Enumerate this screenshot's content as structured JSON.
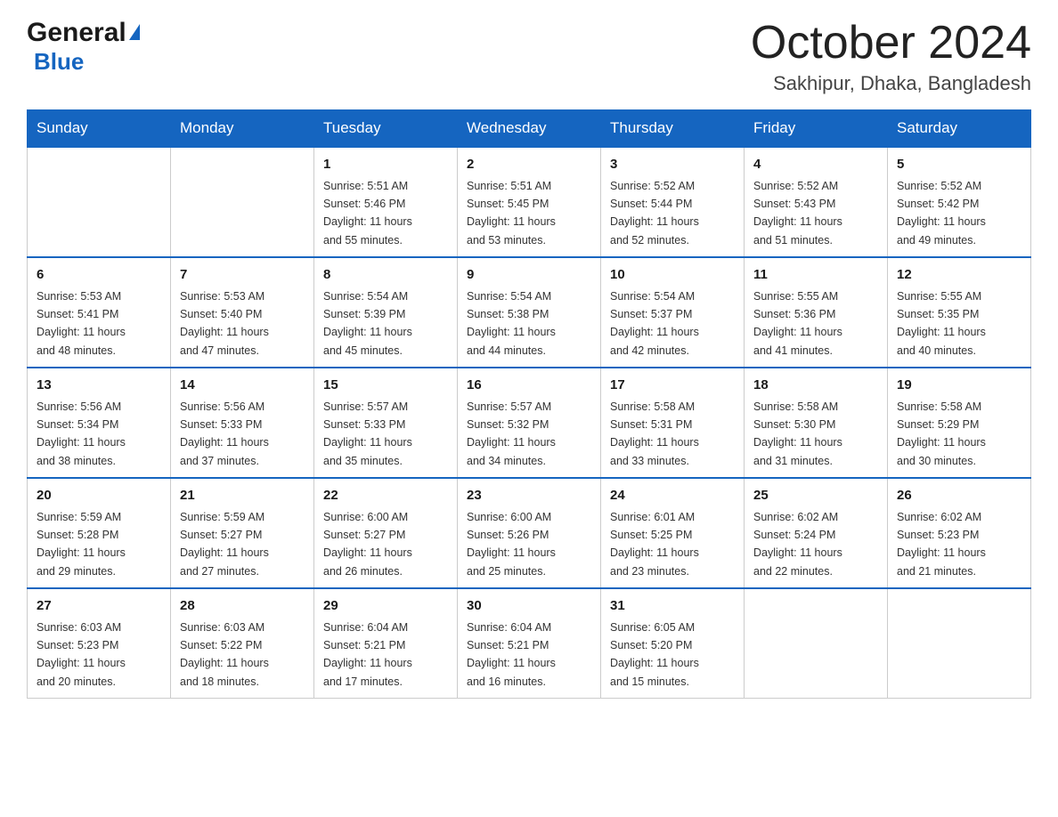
{
  "header": {
    "logo_general": "General",
    "logo_blue": "Blue",
    "month_title": "October 2024",
    "location": "Sakhipur, Dhaka, Bangladesh"
  },
  "weekdays": [
    "Sunday",
    "Monday",
    "Tuesday",
    "Wednesday",
    "Thursday",
    "Friday",
    "Saturday"
  ],
  "weeks": [
    [
      {
        "day": "",
        "info": ""
      },
      {
        "day": "",
        "info": ""
      },
      {
        "day": "1",
        "info": "Sunrise: 5:51 AM\nSunset: 5:46 PM\nDaylight: 11 hours\nand 55 minutes."
      },
      {
        "day": "2",
        "info": "Sunrise: 5:51 AM\nSunset: 5:45 PM\nDaylight: 11 hours\nand 53 minutes."
      },
      {
        "day": "3",
        "info": "Sunrise: 5:52 AM\nSunset: 5:44 PM\nDaylight: 11 hours\nand 52 minutes."
      },
      {
        "day": "4",
        "info": "Sunrise: 5:52 AM\nSunset: 5:43 PM\nDaylight: 11 hours\nand 51 minutes."
      },
      {
        "day": "5",
        "info": "Sunrise: 5:52 AM\nSunset: 5:42 PM\nDaylight: 11 hours\nand 49 minutes."
      }
    ],
    [
      {
        "day": "6",
        "info": "Sunrise: 5:53 AM\nSunset: 5:41 PM\nDaylight: 11 hours\nand 48 minutes."
      },
      {
        "day": "7",
        "info": "Sunrise: 5:53 AM\nSunset: 5:40 PM\nDaylight: 11 hours\nand 47 minutes."
      },
      {
        "day": "8",
        "info": "Sunrise: 5:54 AM\nSunset: 5:39 PM\nDaylight: 11 hours\nand 45 minutes."
      },
      {
        "day": "9",
        "info": "Sunrise: 5:54 AM\nSunset: 5:38 PM\nDaylight: 11 hours\nand 44 minutes."
      },
      {
        "day": "10",
        "info": "Sunrise: 5:54 AM\nSunset: 5:37 PM\nDaylight: 11 hours\nand 42 minutes."
      },
      {
        "day": "11",
        "info": "Sunrise: 5:55 AM\nSunset: 5:36 PM\nDaylight: 11 hours\nand 41 minutes."
      },
      {
        "day": "12",
        "info": "Sunrise: 5:55 AM\nSunset: 5:35 PM\nDaylight: 11 hours\nand 40 minutes."
      }
    ],
    [
      {
        "day": "13",
        "info": "Sunrise: 5:56 AM\nSunset: 5:34 PM\nDaylight: 11 hours\nand 38 minutes."
      },
      {
        "day": "14",
        "info": "Sunrise: 5:56 AM\nSunset: 5:33 PM\nDaylight: 11 hours\nand 37 minutes."
      },
      {
        "day": "15",
        "info": "Sunrise: 5:57 AM\nSunset: 5:33 PM\nDaylight: 11 hours\nand 35 minutes."
      },
      {
        "day": "16",
        "info": "Sunrise: 5:57 AM\nSunset: 5:32 PM\nDaylight: 11 hours\nand 34 minutes."
      },
      {
        "day": "17",
        "info": "Sunrise: 5:58 AM\nSunset: 5:31 PM\nDaylight: 11 hours\nand 33 minutes."
      },
      {
        "day": "18",
        "info": "Sunrise: 5:58 AM\nSunset: 5:30 PM\nDaylight: 11 hours\nand 31 minutes."
      },
      {
        "day": "19",
        "info": "Sunrise: 5:58 AM\nSunset: 5:29 PM\nDaylight: 11 hours\nand 30 minutes."
      }
    ],
    [
      {
        "day": "20",
        "info": "Sunrise: 5:59 AM\nSunset: 5:28 PM\nDaylight: 11 hours\nand 29 minutes."
      },
      {
        "day": "21",
        "info": "Sunrise: 5:59 AM\nSunset: 5:27 PM\nDaylight: 11 hours\nand 27 minutes."
      },
      {
        "day": "22",
        "info": "Sunrise: 6:00 AM\nSunset: 5:27 PM\nDaylight: 11 hours\nand 26 minutes."
      },
      {
        "day": "23",
        "info": "Sunrise: 6:00 AM\nSunset: 5:26 PM\nDaylight: 11 hours\nand 25 minutes."
      },
      {
        "day": "24",
        "info": "Sunrise: 6:01 AM\nSunset: 5:25 PM\nDaylight: 11 hours\nand 23 minutes."
      },
      {
        "day": "25",
        "info": "Sunrise: 6:02 AM\nSunset: 5:24 PM\nDaylight: 11 hours\nand 22 minutes."
      },
      {
        "day": "26",
        "info": "Sunrise: 6:02 AM\nSunset: 5:23 PM\nDaylight: 11 hours\nand 21 minutes."
      }
    ],
    [
      {
        "day": "27",
        "info": "Sunrise: 6:03 AM\nSunset: 5:23 PM\nDaylight: 11 hours\nand 20 minutes."
      },
      {
        "day": "28",
        "info": "Sunrise: 6:03 AM\nSunset: 5:22 PM\nDaylight: 11 hours\nand 18 minutes."
      },
      {
        "day": "29",
        "info": "Sunrise: 6:04 AM\nSunset: 5:21 PM\nDaylight: 11 hours\nand 17 minutes."
      },
      {
        "day": "30",
        "info": "Sunrise: 6:04 AM\nSunset: 5:21 PM\nDaylight: 11 hours\nand 16 minutes."
      },
      {
        "day": "31",
        "info": "Sunrise: 6:05 AM\nSunset: 5:20 PM\nDaylight: 11 hours\nand 15 minutes."
      },
      {
        "day": "",
        "info": ""
      },
      {
        "day": "",
        "info": ""
      }
    ]
  ]
}
